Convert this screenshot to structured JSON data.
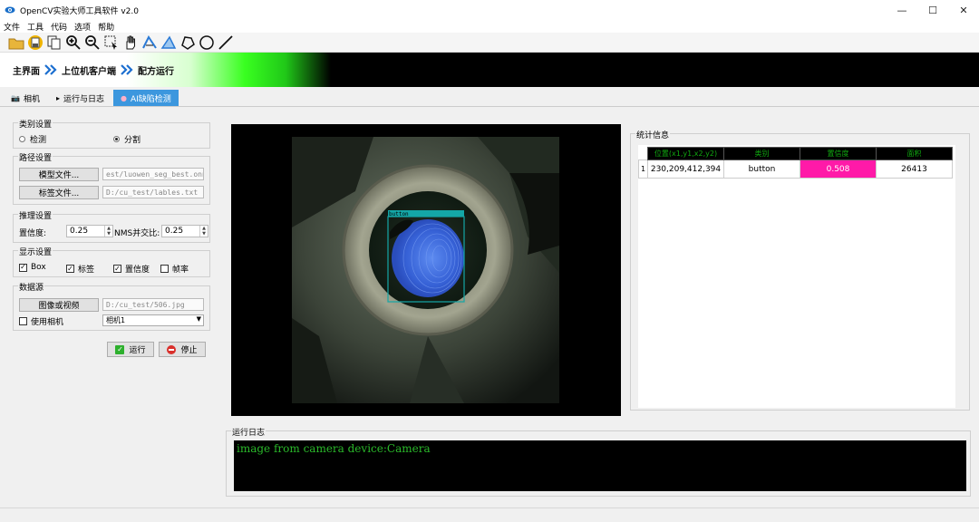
{
  "window": {
    "title": "OpenCV实验大师工具软件 v2.0",
    "controls": {
      "minimize": "—",
      "maximize": "☐",
      "close": "✕"
    }
  },
  "menu": [
    "文件",
    "工具",
    "代码",
    "选项",
    "帮助"
  ],
  "toolbar_icons": [
    "open-folder-icon",
    "save-icon",
    "copy-icon",
    "zoom-in-icon",
    "zoom-out-icon",
    "select-icon",
    "hand-icon",
    "polyline-icon",
    "polyline-alt-icon",
    "polygon-icon",
    "circle-icon",
    "line-icon"
  ],
  "breadcrumb": [
    "主界面",
    "上位机客户端",
    "配方运行"
  ],
  "tabs": [
    "相机",
    "运行与日志",
    "AI缺陷检测"
  ],
  "category": {
    "title": "类别设置",
    "option1": "检测",
    "option2": "分割",
    "selected": "分割"
  },
  "paths": {
    "title": "路径设置",
    "model_button": "模型文件...",
    "model_value": "est/luowen_seg_best.onnx",
    "label_button": "标签文件...",
    "label_value": "D:/cu_test/lables.txt"
  },
  "inference": {
    "title": "推理设置",
    "conf_label": "置信度:",
    "conf_value": "0.25",
    "nms_label": "NMS并交比:",
    "nms_value": "0.25"
  },
  "display": {
    "title": "显示设置",
    "box": {
      "label": "Box",
      "checked": true
    },
    "tag": {
      "label": "标签",
      "checked": true
    },
    "confidence": {
      "label": "置信度",
      "checked": true
    },
    "fps": {
      "label": "帧率",
      "checked": false
    }
  },
  "source": {
    "title": "数据源",
    "image_button": "图像或视频",
    "image_value": "D:/cu_test/506.jpg",
    "camera_label": "使用相机",
    "camera_checked": false,
    "camera_select": "相机1"
  },
  "actions": {
    "run": "运行",
    "stop": "停止"
  },
  "detection": {
    "label": "button"
  },
  "stats": {
    "title": "统计信息",
    "headers": [
      "位置(x1,y1,x2,y2)",
      "类别",
      "置信度",
      "面积"
    ],
    "rows": [
      {
        "index": "1",
        "position": "230,209,412,394",
        "category": "button",
        "confidence": "0.508",
        "area": "26413"
      }
    ],
    "highlight_color": "#ff1aa8",
    "header_text_color": "#10a810"
  },
  "log": {
    "title": "运行日志",
    "text": "image from camera device:Camera",
    "text_color": "#2ab82a"
  }
}
